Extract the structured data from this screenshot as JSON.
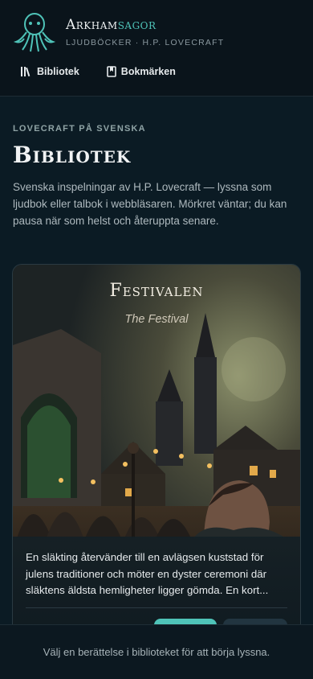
{
  "brand": {
    "title_main": "Arkham",
    "title_accent": "sagor",
    "subtitle": "Ljudböcker · H.P. Lovecraft"
  },
  "nav": [
    {
      "label": "Bibliotek",
      "icon": "library-icon"
    },
    {
      "label": "Bokmärken",
      "icon": "bookmark-icon"
    }
  ],
  "intro": {
    "eyebrow": "Lovecraft på svenska",
    "title": "Bibliotek",
    "text": "Svenska inspelningar av H.P. Lovecraft — lyssna som ljudbok eller talbok i webbläsaren. Mörkret väntar; du kan pausa när som helst och återuppta senare."
  },
  "card": {
    "title": "Festivalen",
    "subtitle": "The Festival",
    "description": "En släkting återvänder till en avlägsen kuststad för julens traditioner och möter en dyster ceremoni där släktens äldsta hemligheter ligger gömda. En kort...",
    "play_label": "",
    "read_label": ""
  },
  "footer": {
    "text": "Välj en berättelse i biblioteket för att börja lyssna."
  },
  "colors": {
    "accent": "#4fc3b8",
    "background": "#0b1b24",
    "header": "#0a141b"
  }
}
